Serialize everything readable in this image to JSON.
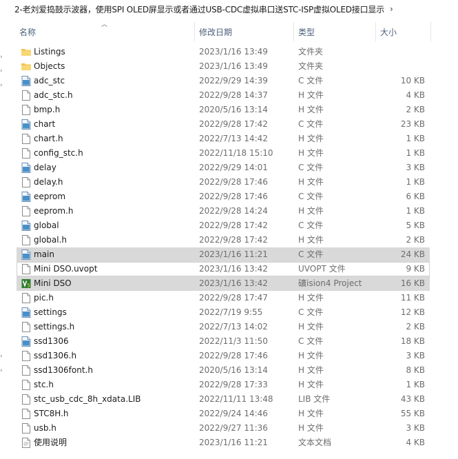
{
  "breadcrumb": {
    "path": "2-老刘爱捣鼓示波器，使用SPI OLED屏显示或者通过USB-CDC虚拟串口送STC-ISP虚拟OLED接口显示",
    "chevron": "›"
  },
  "columns": {
    "name": "名称",
    "date": "修改日期",
    "type": "类型",
    "size": "大小"
  },
  "files": [
    {
      "name": "Listings",
      "date": "2023/1/16 13:49",
      "type": "文件夹",
      "size": "",
      "icon": "folder-icon"
    },
    {
      "name": "Objects",
      "date": "2023/1/16 13:49",
      "type": "文件夹",
      "size": "",
      "icon": "folder-icon"
    },
    {
      "name": "adc_stc",
      "date": "2022/9/29 14:39",
      "type": "C 文件",
      "size": "10 KB",
      "icon": "c-file-icon"
    },
    {
      "name": "adc_stc.h",
      "date": "2022/9/28 14:37",
      "type": "H 文件",
      "size": "4 KB",
      "icon": "h-file-icon"
    },
    {
      "name": "bmp.h",
      "date": "2020/5/16 13:14",
      "type": "H 文件",
      "size": "2 KB",
      "icon": "h-file-icon"
    },
    {
      "name": "chart",
      "date": "2022/9/28 17:42",
      "type": "C 文件",
      "size": "23 KB",
      "icon": "c-file-icon"
    },
    {
      "name": "chart.h",
      "date": "2022/7/13 14:42",
      "type": "H 文件",
      "size": "1 KB",
      "icon": "h-file-icon"
    },
    {
      "name": "config_stc.h",
      "date": "2022/11/18 15:10",
      "type": "H 文件",
      "size": "1 KB",
      "icon": "h-file-icon"
    },
    {
      "name": "delay",
      "date": "2022/9/29 14:01",
      "type": "C 文件",
      "size": "3 KB",
      "icon": "c-file-icon"
    },
    {
      "name": "delay.h",
      "date": "2022/9/28 17:46",
      "type": "H 文件",
      "size": "1 KB",
      "icon": "h-file-icon"
    },
    {
      "name": "eeprom",
      "date": "2022/9/28 17:46",
      "type": "C 文件",
      "size": "6 KB",
      "icon": "c-file-icon"
    },
    {
      "name": "eeprom.h",
      "date": "2022/9/28 14:24",
      "type": "H 文件",
      "size": "1 KB",
      "icon": "h-file-icon"
    },
    {
      "name": "global",
      "date": "2022/9/28 17:42",
      "type": "C 文件",
      "size": "5 KB",
      "icon": "c-file-icon"
    },
    {
      "name": "global.h",
      "date": "2022/9/28 17:42",
      "type": "H 文件",
      "size": "2 KB",
      "icon": "h-file-icon"
    },
    {
      "name": "main",
      "date": "2023/1/16 11:21",
      "type": "C 文件",
      "size": "24 KB",
      "icon": "c-file-icon",
      "state": "sel"
    },
    {
      "name": "Mini DSO.uvopt",
      "date": "2023/1/16 13:42",
      "type": "UVOPT 文件",
      "size": "9 KB",
      "icon": "uvopt-file-icon",
      "state": "border"
    },
    {
      "name": "Mini DSO",
      "date": "2023/1/16 13:42",
      "type": "礦ision4 Project",
      "size": "16 KB",
      "icon": "keil-project-icon",
      "state": "sel"
    },
    {
      "name": "pic.h",
      "date": "2022/9/28 17:47",
      "type": "H 文件",
      "size": "11 KB",
      "icon": "h-file-icon"
    },
    {
      "name": "settings",
      "date": "2022/7/19 9:55",
      "type": "C 文件",
      "size": "12 KB",
      "icon": "c-file-icon"
    },
    {
      "name": "settings.h",
      "date": "2022/7/13 14:02",
      "type": "H 文件",
      "size": "2 KB",
      "icon": "h-file-icon"
    },
    {
      "name": "ssd1306",
      "date": "2022/11/3 11:50",
      "type": "C 文件",
      "size": "18 KB",
      "icon": "c-file-icon"
    },
    {
      "name": "ssd1306.h",
      "date": "2022/9/28 17:46",
      "type": "H 文件",
      "size": "3 KB",
      "icon": "h-file-icon"
    },
    {
      "name": "ssd1306font.h",
      "date": "2020/5/16 13:14",
      "type": "H 文件",
      "size": "8 KB",
      "icon": "h-file-icon"
    },
    {
      "name": "stc.h",
      "date": "2022/9/28 17:33",
      "type": "H 文件",
      "size": "1 KB",
      "icon": "h-file-icon"
    },
    {
      "name": "stc_usb_cdc_8h_xdata.LIB",
      "date": "2022/11/11 13:48",
      "type": "LIB 文件",
      "size": "43 KB",
      "icon": "lib-file-icon"
    },
    {
      "name": "STC8H.h",
      "date": "2022/9/24 14:46",
      "type": "H 文件",
      "size": "55 KB",
      "icon": "h-file-icon"
    },
    {
      "name": "usb.h",
      "date": "2022/9/27 11:36",
      "type": "H 文件",
      "size": "3 KB",
      "icon": "h-file-icon"
    },
    {
      "name": "使用说明",
      "date": "2023/1/16 11:21",
      "type": "文本文档",
      "size": "4 KB",
      "icon": "text-file-icon"
    }
  ],
  "colors": {
    "selection": "#d9d9d9",
    "header_text": "#4c607a",
    "folder": "#f6c94d",
    "c_file": "#4a90c8"
  }
}
